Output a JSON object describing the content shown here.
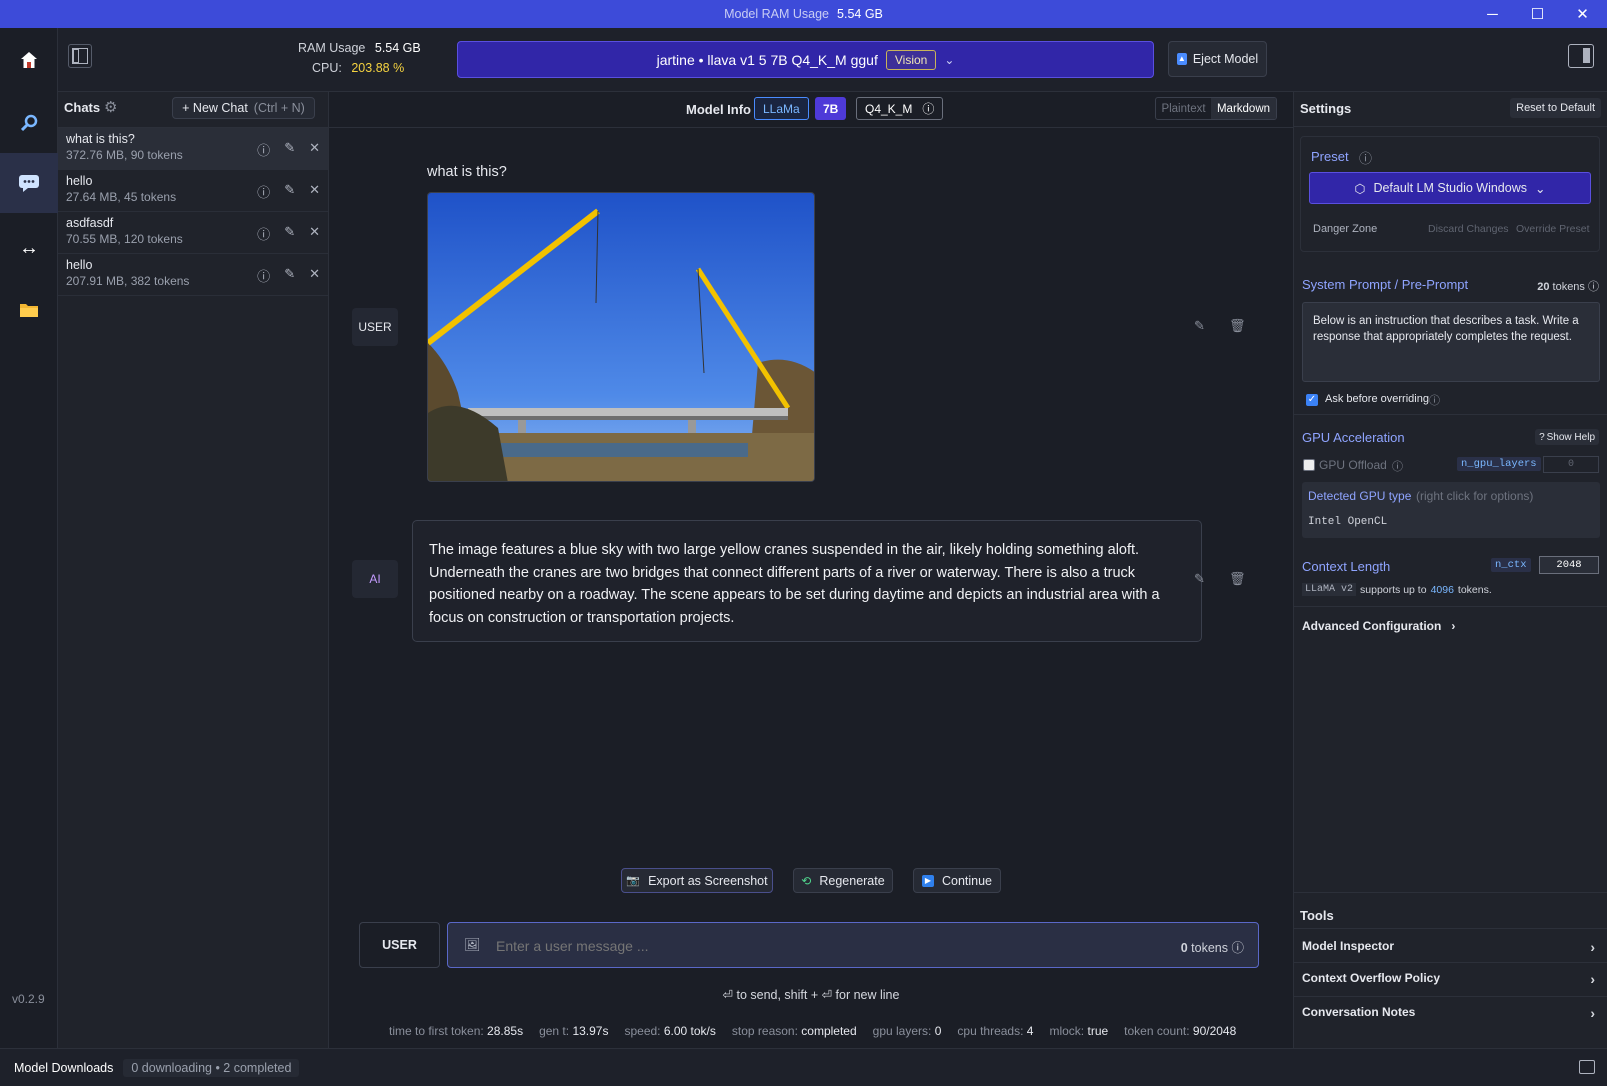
{
  "titlebar": {
    "label": "Model RAM Usage",
    "value": "5.54 GB"
  },
  "nav": {
    "version": "v0.2.9"
  },
  "topbar": {
    "ram_label": "RAM Usage",
    "ram_value": "5.54 GB",
    "cpu_label": "CPU:",
    "cpu_value": "203.88 %",
    "model_name": "jartine • llava v1 5 7B Q4_K_M gguf",
    "vision_badge": "Vision",
    "eject_label": "Eject Model"
  },
  "chats": {
    "header": "Chats",
    "new_chat": "+ New Chat",
    "new_chat_shortcut": "(Ctrl + N)",
    "items": [
      {
        "title": "what is this?",
        "sub": "372.76 MB, 90 tokens"
      },
      {
        "title": "hello",
        "sub": "27.64 MB, 45 tokens"
      },
      {
        "title": "asdfasdf",
        "sub": "70.55 MB, 120 tokens"
      },
      {
        "title": "hello",
        "sub": "207.91 MB, 382 tokens"
      }
    ]
  },
  "modelinfo": {
    "label": "Model Info",
    "arch": "LLaMa",
    "size": "7B",
    "quant": "Q4_K_M",
    "plaintext": "Plaintext",
    "markdown": "Markdown"
  },
  "messages": {
    "user_role": "USER",
    "user_text": "what is this?",
    "ai_role": "AI",
    "ai_text": "The image features a blue sky with two large yellow cranes suspended in the air, likely holding something aloft. Underneath the cranes are two bridges that connect different parts of a river or waterway. There is also a truck positioned nearby on a roadway. The scene appears to be set during daytime and depicts an industrial area with a focus on construction or transportation projects."
  },
  "actions": {
    "export": "Export as Screenshot",
    "regenerate": "Regenerate",
    "continue": "Continue"
  },
  "input": {
    "role": "USER",
    "placeholder": "Enter a user message ...",
    "tokens_count": "0",
    "tokens_label": "tokens",
    "hint": "⏎ to send, shift + ⏎ for new line"
  },
  "stats": [
    {
      "label": "time to first token:",
      "value": "28.85s"
    },
    {
      "label": "gen t:",
      "value": "13.97s"
    },
    {
      "label": "speed:",
      "value": "6.00 tok/s"
    },
    {
      "label": "stop reason:",
      "value": "completed"
    },
    {
      "label": "gpu layers:",
      "value": "0"
    },
    {
      "label": "cpu threads:",
      "value": "4"
    },
    {
      "label": "mlock:",
      "value": "true"
    },
    {
      "label": "token count:",
      "value": "90/2048"
    }
  ],
  "settings": {
    "title": "Settings",
    "reset": "Reset to Default",
    "preset_label": "Preset",
    "preset_value": "Default LM Studio Windows",
    "danger_zone": "Danger Zone",
    "discard": "Discard Changes",
    "override": "Override Preset",
    "system_prompt_label": "System Prompt / Pre-Prompt",
    "system_prompt_tokens": "20",
    "tokens_word": "tokens",
    "system_prompt": "Below is an instruction that describes a task. Write a response that appropriately completes the request.",
    "ask_override": "Ask before overriding",
    "gpu_label": "GPU Acceleration",
    "show_help": "Show Help",
    "gpu_offload": "GPU Offload",
    "n_gpu_layers": "n_gpu_layers",
    "n_gpu_value": "0",
    "detected_gpu": "Detected GPU type",
    "detected_hint": "(right click for options)",
    "gpu_type": "Intel OpenCL",
    "context_label": "Context Length",
    "n_ctx": "n_ctx",
    "n_ctx_value": "2048",
    "supports_model": "LLaMA v2",
    "supports_text": "supports up to",
    "supports_value": "4096",
    "supports_suffix": "tokens.",
    "advanced": "Advanced Configuration",
    "tools": "Tools",
    "tool_items": [
      "Model Inspector",
      "Context Overflow Policy",
      "Conversation Notes"
    ]
  },
  "downloads": {
    "label": "Model Downloads",
    "status": "0 downloading • 2 completed"
  },
  "colors": {
    "accent": "#3d4bd9",
    "cpu": "#f5d340",
    "link": "#8fa4ff"
  }
}
